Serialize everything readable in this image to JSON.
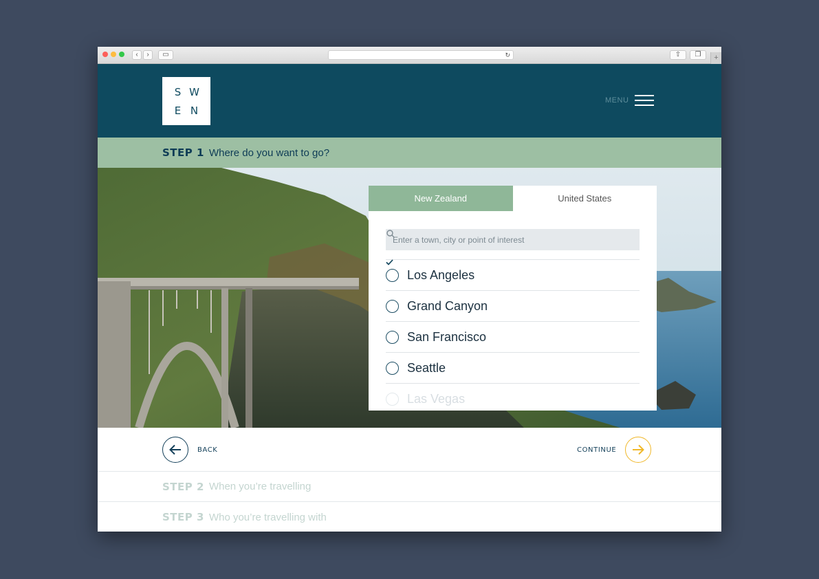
{
  "brand": {
    "logo_letters": [
      "S",
      "W",
      "E",
      "N"
    ]
  },
  "header": {
    "menu_label": "MENU"
  },
  "steps": {
    "current": {
      "number": "STEP 1",
      "title": "Where do you want to go?"
    },
    "next": [
      {
        "number": "STEP 2",
        "title": "When you’re travelling"
      },
      {
        "number": "STEP 3",
        "title": "Who you’re travelling with"
      }
    ]
  },
  "card": {
    "tabs": [
      {
        "label": "New Zealand",
        "active": true
      },
      {
        "label": "United States",
        "active": false
      }
    ],
    "search": {
      "placeholder": "Enter a town, city or point of interest",
      "value": ""
    },
    "destinations": [
      {
        "label": "Los Angeles",
        "checked": true
      },
      {
        "label": "Grand Canyon",
        "checked": false
      },
      {
        "label": "San Francisco",
        "checked": false
      },
      {
        "label": "Seattle",
        "checked": true
      },
      {
        "label": "Las Vegas",
        "checked": false
      }
    ]
  },
  "nav": {
    "back_label": "BACK",
    "continue_label": "CONTINUE"
  },
  "colors": {
    "header_bg": "#0e4a5f",
    "step_bar_bg": "#9dbfa3",
    "tab_active_bg": "#8fb798",
    "continue_accent": "#f0b82a",
    "page_bg": "#3e4a5f"
  },
  "icons": {
    "search": "search-icon",
    "back": "arrow-left-icon",
    "continue": "arrow-right-icon",
    "menu": "hamburger-icon",
    "checked": "check-icon"
  }
}
